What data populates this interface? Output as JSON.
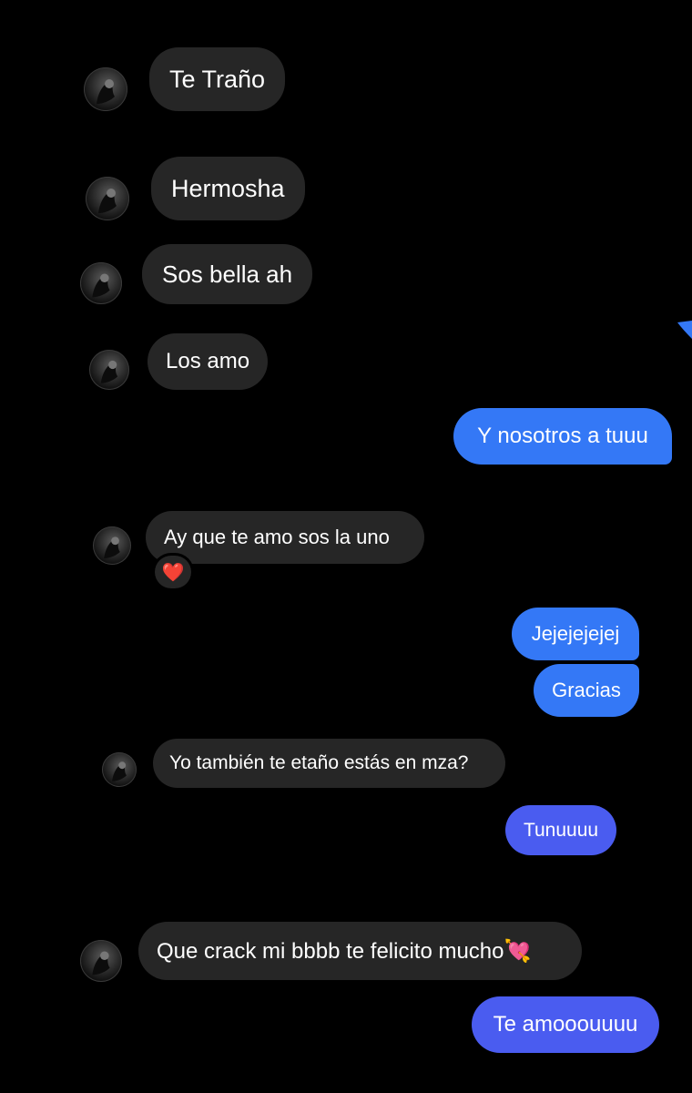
{
  "conversation": {
    "messages": [
      {
        "direction": "incoming",
        "text": "Te Traño"
      },
      {
        "direction": "incoming",
        "text": "Hermosha"
      },
      {
        "direction": "incoming",
        "text": "Sos bella ah"
      },
      {
        "direction": "incoming",
        "text": "Los amo"
      },
      {
        "direction": "outgoing",
        "text": "Y nosotros a tuuu"
      },
      {
        "direction": "incoming",
        "text": "Ay que te amo sos la uno",
        "reaction": "❤️"
      },
      {
        "direction": "outgoing",
        "text": "Jejejejejej"
      },
      {
        "direction": "outgoing",
        "text": "Gracias"
      },
      {
        "direction": "incoming",
        "text": "Yo también te etaño estás en mza?"
      },
      {
        "direction": "outgoing",
        "text": "Tunuuuu"
      },
      {
        "direction": "incoming",
        "text": "Que crack mi bbbb te felicito mucho💘"
      },
      {
        "direction": "outgoing",
        "text": "Te amooouuuu"
      }
    ]
  },
  "colors": {
    "background": "#000000",
    "incoming_bubble": "#262626",
    "outgoing_bubble": "#3478f6",
    "outgoing_bubble_alt": "#4a5cf0",
    "text": "#ffffff"
  },
  "icons": {
    "avatar": "contact-avatar-icon",
    "reaction": "heart-reaction-icon"
  }
}
